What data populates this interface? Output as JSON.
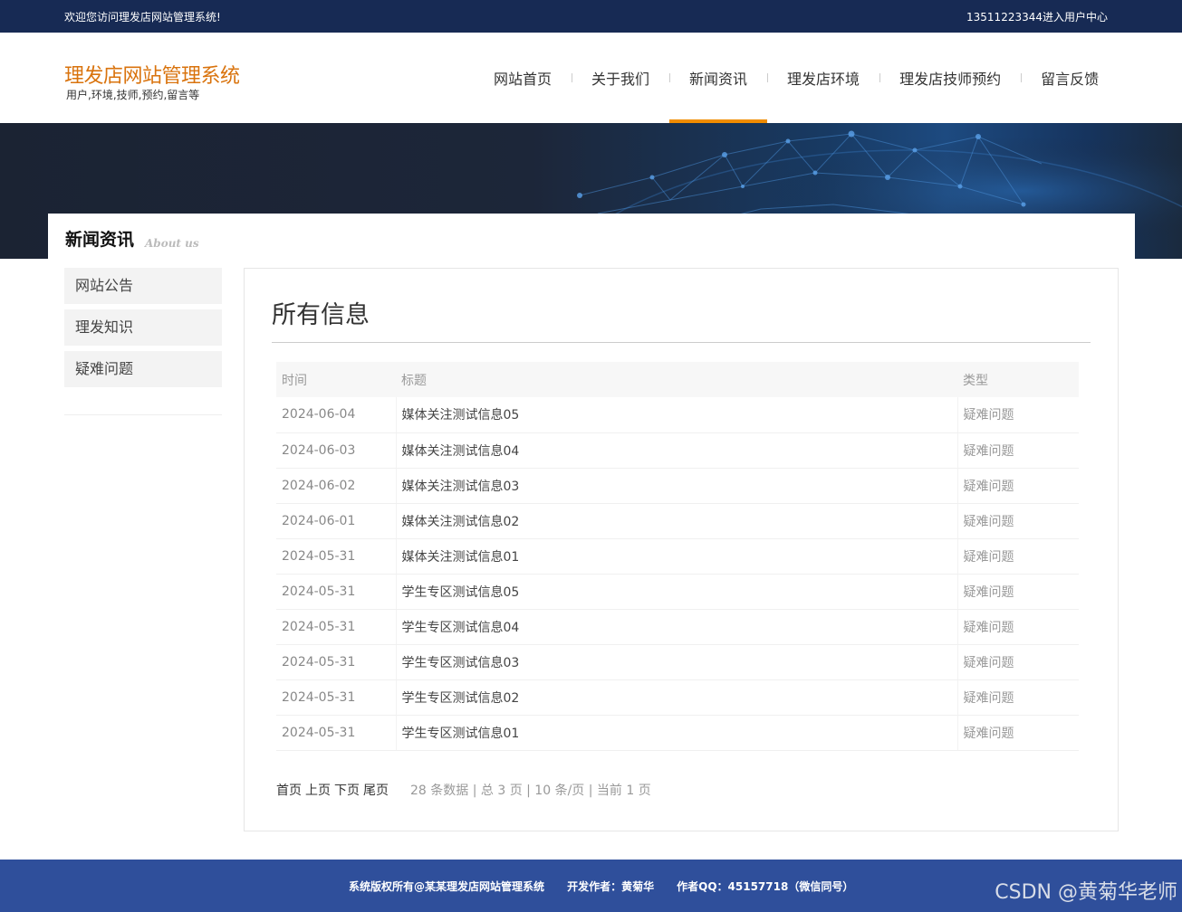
{
  "topbar": {
    "welcome": "欢迎您访问理发店网站管理系统!",
    "user_link": "13511223344进入用户中心"
  },
  "header": {
    "logo_title": "理发店网站管理系统",
    "logo_subtitle": "用户,环境,技师,预约,留言等",
    "nav": [
      {
        "label": "网站首页",
        "active": false
      },
      {
        "label": "关于我们",
        "active": false
      },
      {
        "label": "新闻资讯",
        "active": true
      },
      {
        "label": "理发店环境",
        "active": false
      },
      {
        "label": "理发店技师预约",
        "active": false
      },
      {
        "label": "留言反馈",
        "active": false
      }
    ],
    "active_color": "#f08c00"
  },
  "section": {
    "title": "新闻资讯",
    "title_en": "About us"
  },
  "sidebar": {
    "items": [
      "网站公告",
      "理发知识",
      "疑难问题"
    ]
  },
  "main": {
    "heading": "所有信息",
    "columns": [
      "时间",
      "标题",
      "类型"
    ],
    "rows": [
      {
        "date": "2024-06-04",
        "title": "媒体关注测试信息05",
        "type": "疑难问题"
      },
      {
        "date": "2024-06-03",
        "title": "媒体关注测试信息04",
        "type": "疑难问题"
      },
      {
        "date": "2024-06-02",
        "title": "媒体关注测试信息03",
        "type": "疑难问题"
      },
      {
        "date": "2024-06-01",
        "title": "媒体关注测试信息02",
        "type": "疑难问题"
      },
      {
        "date": "2024-05-31",
        "title": "媒体关注测试信息01",
        "type": "疑难问题"
      },
      {
        "date": "2024-05-31",
        "title": "学生专区测试信息05",
        "type": "疑难问题"
      },
      {
        "date": "2024-05-31",
        "title": "学生专区测试信息04",
        "type": "疑难问题"
      },
      {
        "date": "2024-05-31",
        "title": "学生专区测试信息03",
        "type": "疑难问题"
      },
      {
        "date": "2024-05-31",
        "title": "学生专区测试信息02",
        "type": "疑难问题"
      },
      {
        "date": "2024-05-31",
        "title": "学生专区测试信息01",
        "type": "疑难问题"
      }
    ],
    "pager": {
      "first": "首页",
      "prev": "上页",
      "next": "下页",
      "last": "尾页",
      "info": "28 条数据 | 总 3 页 | 10 条/页 | 当前 1 页"
    }
  },
  "footer": {
    "text": "系统版权所有@某某理发店网站管理系统      开发作者：黄菊华      作者QQ：45157718（微信同号）"
  },
  "watermark": "CSDN @黄菊华老师"
}
